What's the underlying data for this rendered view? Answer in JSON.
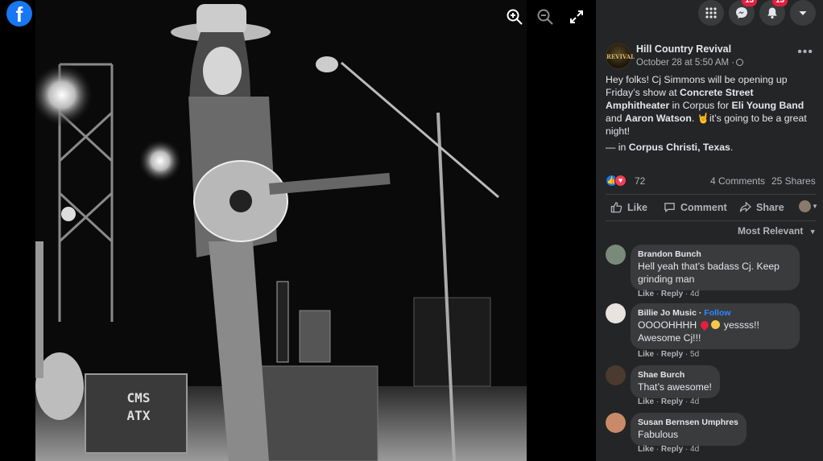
{
  "viewer": {
    "logo_text": "f"
  },
  "topbar": {
    "messenger_badge": "13",
    "notifications_badge": "13"
  },
  "post": {
    "page_name": "Hill Country Revival",
    "avatar_text": "REVIVAL",
    "time": "October 28 at 5:50 AM ·",
    "text_parts": {
      "p1": "Hey folks! Cj Simmons will be opening up Friday’s show at ",
      "venue": "Concrete Street Amphitheater",
      "p2": " in Corpus for ",
      "act1": "Eli Young Band",
      "p3": " and ",
      "act2": "Aaron Watson",
      "p4": ". 🤘it’s going to be a great night!"
    },
    "location_prefix": "— in ",
    "location": "Corpus Christi, Texas",
    "location_suffix": ".",
    "reaction_count": "72",
    "comments_count": "4 Comments",
    "shares_count": "25 Shares"
  },
  "actions": {
    "like": "Like",
    "comment": "Comment",
    "share": "Share"
  },
  "sort_label": "Most Relevant",
  "comments": [
    {
      "name": "Brandon Bunch",
      "text": "Hell yeah that’s badass Cj. Keep grinding man",
      "like": "Like",
      "reply": "Reply",
      "age": "4d",
      "avatar_color": "#7a8a7a"
    },
    {
      "name": "Billie Jo Music",
      "follow": "Follow",
      "text_a": "OOOOHHHH ",
      "text_b": " yessss!! Awesome Cj!!!",
      "like": "Like",
      "reply": "Reply",
      "age": "5d",
      "avatar_color": "#e9e3e0"
    },
    {
      "name": "Shae Burch",
      "text": "That’s awesome!",
      "like": "Like",
      "reply": "Reply",
      "age": "4d",
      "avatar_color": "#4a3a30"
    },
    {
      "name": "Susan Bernsen Umphres",
      "text": "Fabulous",
      "like": "Like",
      "reply": "Reply",
      "age": "4d",
      "avatar_color": "#c98a6a"
    }
  ]
}
